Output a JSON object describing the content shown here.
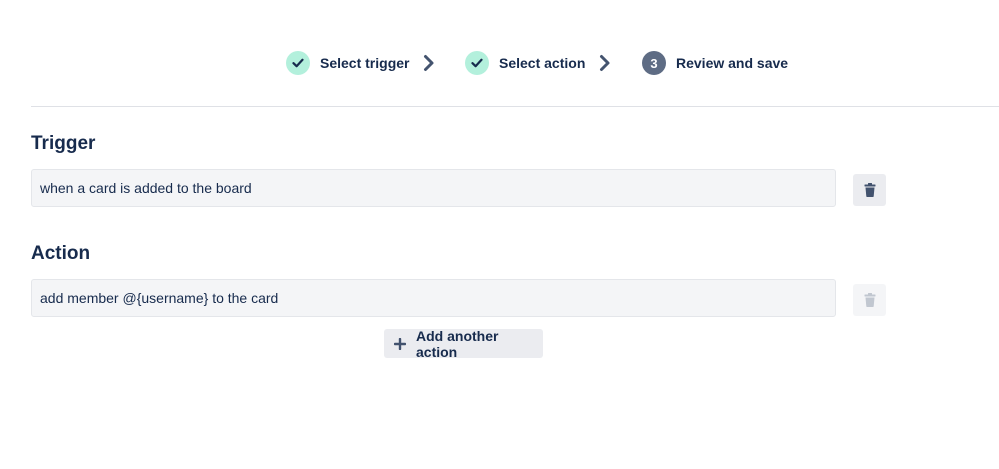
{
  "stepper": {
    "steps": [
      {
        "label": "Select trigger",
        "status": "completed"
      },
      {
        "label": "Select action",
        "status": "completed"
      },
      {
        "label": "Review and save",
        "status": "current",
        "number": "3"
      }
    ]
  },
  "trigger": {
    "heading": "Trigger",
    "value": "when a card is added to the board",
    "delete_enabled": true
  },
  "action": {
    "heading": "Action",
    "value": "add member @{username} to the card",
    "delete_enabled": false
  },
  "add_action": {
    "label": "Add another action"
  },
  "icons": {
    "completed_step": "check-icon",
    "separator": "chevron-right-icon",
    "delete": "trash-icon",
    "add": "plus-icon"
  },
  "colors": {
    "completed_circle": "#b3f0dc",
    "check": "#172b4d",
    "current_circle": "#5e6c84",
    "text": "#172b4d",
    "box_background": "#f4f5f7"
  }
}
